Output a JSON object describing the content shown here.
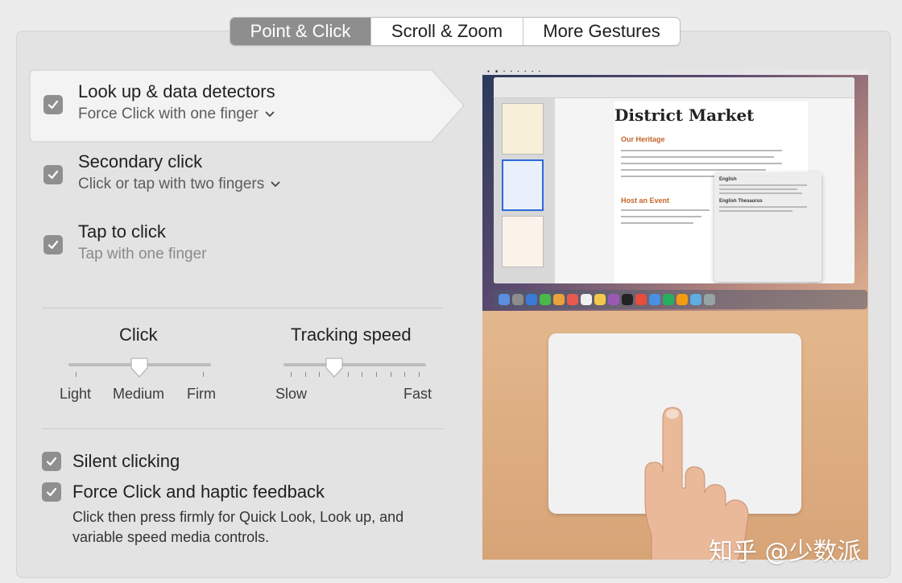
{
  "tabs": [
    {
      "label": "Point & Click",
      "active": true
    },
    {
      "label": "Scroll & Zoom",
      "active": false
    },
    {
      "label": "More Gestures",
      "active": false
    }
  ],
  "options": [
    {
      "title": "Look up & data detectors",
      "subtitle": "Force Click with one finger",
      "checked": true,
      "has_menu": true,
      "selected": true
    },
    {
      "title": "Secondary click",
      "subtitle": "Click or tap with two fingers",
      "checked": true,
      "has_menu": true,
      "selected": false
    },
    {
      "title": "Tap to click",
      "subtitle": "Tap with one finger",
      "checked": true,
      "has_menu": false,
      "selected": false
    }
  ],
  "sliders": {
    "click": {
      "label": "Click",
      "labels": [
        "Light",
        "Medium",
        "Firm"
      ],
      "value": "Medium"
    },
    "tracking": {
      "label": "Tracking speed",
      "min_label": "Slow",
      "max_label": "Fast",
      "value_fraction": 0.35
    }
  },
  "bottom": {
    "silent_clicking": {
      "label": "Silent clicking",
      "checked": true
    },
    "force_click": {
      "label": "Force Click and haptic feedback",
      "checked": true,
      "description": "Click then press firmly for Quick Look, Look up, and variable speed media controls."
    }
  },
  "preview": {
    "document_title": "District Market",
    "heading_1": "Our Heritage",
    "heading_2": "Host an Event",
    "lookup_section_1": "English",
    "lookup_section_2": "English Thesaurus"
  },
  "watermark": "知乎 @少数派",
  "colors": {
    "checkbox": "#8f8f8f",
    "active_tab": "#8e8e8e",
    "background": "#e3e3e3"
  }
}
